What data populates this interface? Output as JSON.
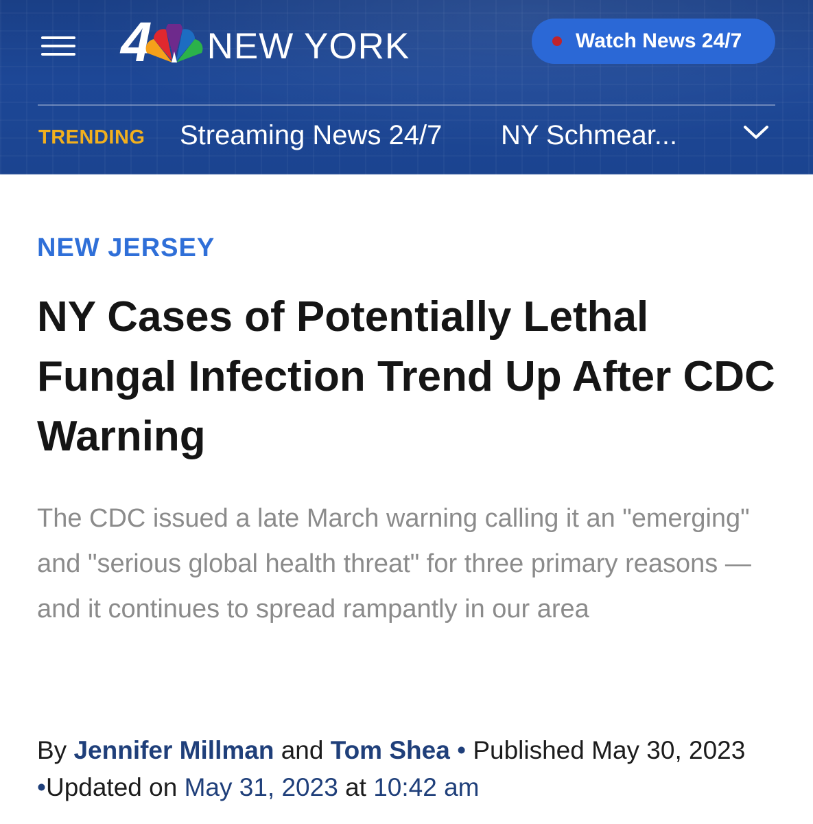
{
  "header": {
    "logo_number": "4",
    "logo_city": "NEW YORK",
    "watch_button_label": "Watch News 24/7",
    "trending_label": "TRENDING",
    "trending_links": [
      "Streaming News 24/7",
      "NY Schmear..."
    ],
    "colors": {
      "header_bg": "#1d4796",
      "watch_button": "#2b68d6",
      "live_dot": "#c0232b",
      "trending": "#f2b01e"
    }
  },
  "article": {
    "kicker": "NEW JERSEY",
    "headline": "NY Cases of Potentially Lethal Fungal Infection Trend Up After CDC Warning",
    "dek": "The CDC issued a late March warning calling it an \"emerging\" and \"serious global health threat\" for three primary reasons — and it continues to spread rampantly in our area",
    "byline": {
      "by": "By",
      "author1": "Jennifer Millman",
      "and": "and",
      "author2": "Tom Shea",
      "bullet": "•",
      "published_label": "Published",
      "published_date": "May 30, 2023",
      "updated_label": "Updated on",
      "updated_date": "May 31, 2023",
      "at": "at",
      "updated_time": "10:42 am"
    },
    "colors": {
      "kicker": "#2f6fd8",
      "author_link": "#1f3f7a"
    }
  }
}
